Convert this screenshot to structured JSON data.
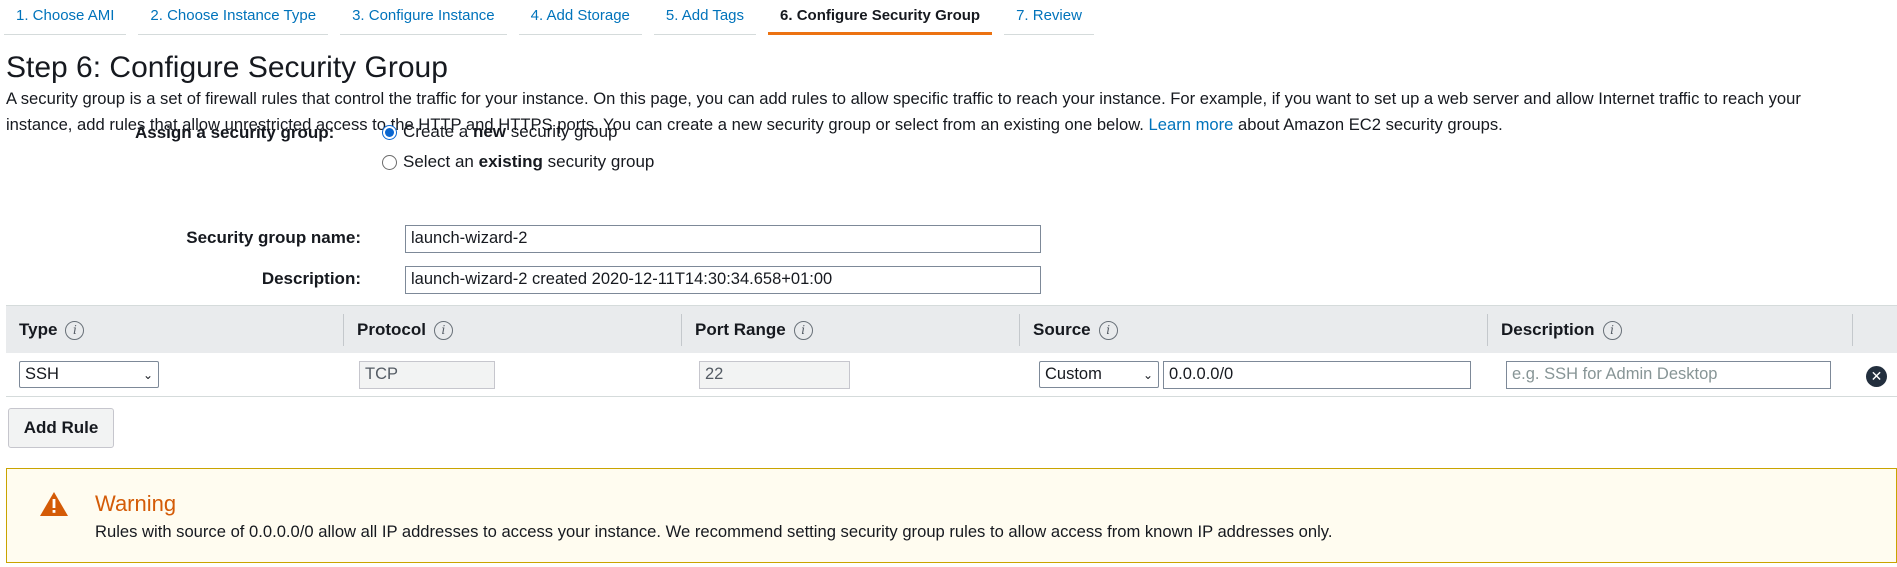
{
  "wizard": {
    "tabs": [
      "1. Choose AMI",
      "2. Choose Instance Type",
      "3. Configure Instance",
      "4. Add Storage",
      "5. Add Tags",
      "6. Configure Security Group",
      "7. Review"
    ],
    "active_tab": "6. Configure Security Group"
  },
  "page": {
    "title": "Step 6: Configure Security Group",
    "intro_line1": "A security group is a set of firewall rules that control the traffic for your instance. On this page, you can add rules to allow specific traffic to reach your instance. For example, if you want to set up a web server and allow Internet traffic to reach your",
    "intro_line2_pre": "instance, add rules that allow unrestricted access to the HTTP and HTTPS ports. You can create a new security group or select from an existing one below.",
    "intro_link": "Learn more",
    "intro_line2_post": "about Amazon EC2 security groups."
  },
  "assign": {
    "label": "Assign a security group:",
    "option_new_pre": "Create a",
    "option_new_bold": "new",
    "option_new_post": "security group",
    "option_existing_pre": "Select an",
    "option_existing_bold": "existing",
    "option_existing_post": "security group",
    "selected": "new"
  },
  "fields": {
    "name_label": "Security group name:",
    "name_value": "launch-wizard-2",
    "description_label": "Description:",
    "description_value": "launch-wizard-2 created 2020-12-11T14:30:34.658+01:00"
  },
  "rules": {
    "columns": [
      "Type",
      "Protocol",
      "Port Range",
      "Source",
      "Description"
    ],
    "rows": [
      {
        "type": "SSH",
        "protocol": "TCP",
        "port_range": "22",
        "source_type": "Custom",
        "source_value": "0.0.0.0/0",
        "description_placeholder": "e.g. SSH for Admin Desktop"
      }
    ],
    "add_rule_label": "Add Rule"
  },
  "warning": {
    "title": "Warning",
    "text": "Rules with source of 0.0.0.0/0 allow all IP addresses to access your instance. We recommend setting security group rules to allow access from known IP addresses only."
  },
  "colors": {
    "link": "#0073bb",
    "active_tab_underline": "#ec7211",
    "warning_title": "#d45b07",
    "warning_background": "#fffcf0",
    "warning_border": "#c9a400"
  },
  "icons": {
    "info": "info-icon",
    "remove": "close-circle-icon",
    "warning": "warning-triangle-icon",
    "dropdown": "chevron-down-icon"
  }
}
